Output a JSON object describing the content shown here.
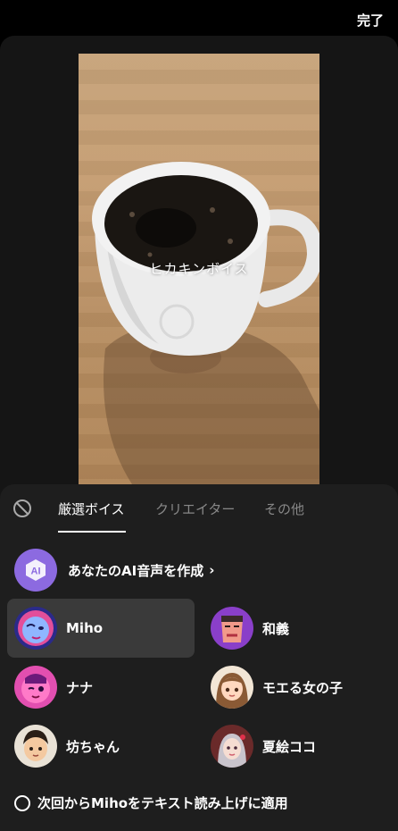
{
  "header": {
    "done_label": "完了"
  },
  "preview": {
    "caption": "ヒカキンボイス"
  },
  "tabs": [
    {
      "label": "厳選ボイス",
      "active": true
    },
    {
      "label": "クリエイター",
      "active": false
    },
    {
      "label": "その他",
      "active": false
    }
  ],
  "create_voice": {
    "badge": "AI",
    "label": "あなたのAI音声を作成",
    "chevron": "›"
  },
  "voices": [
    {
      "name": "Miho",
      "selected": true
    },
    {
      "name": "和義",
      "selected": false
    },
    {
      "name": "ナナ",
      "selected": false
    },
    {
      "name": "モエる女の子",
      "selected": false
    },
    {
      "name": "坊ちゃん",
      "selected": false
    },
    {
      "name": "夏絵ココ",
      "selected": false
    }
  ],
  "apply_option": {
    "label": "次回からMihoをテキスト読み上げに適用",
    "checked": false
  },
  "colors": {
    "accent_purple": "#8c6ae0",
    "sheet_bg": "#1e1e1e",
    "selected_bg": "#3a3a3a"
  }
}
